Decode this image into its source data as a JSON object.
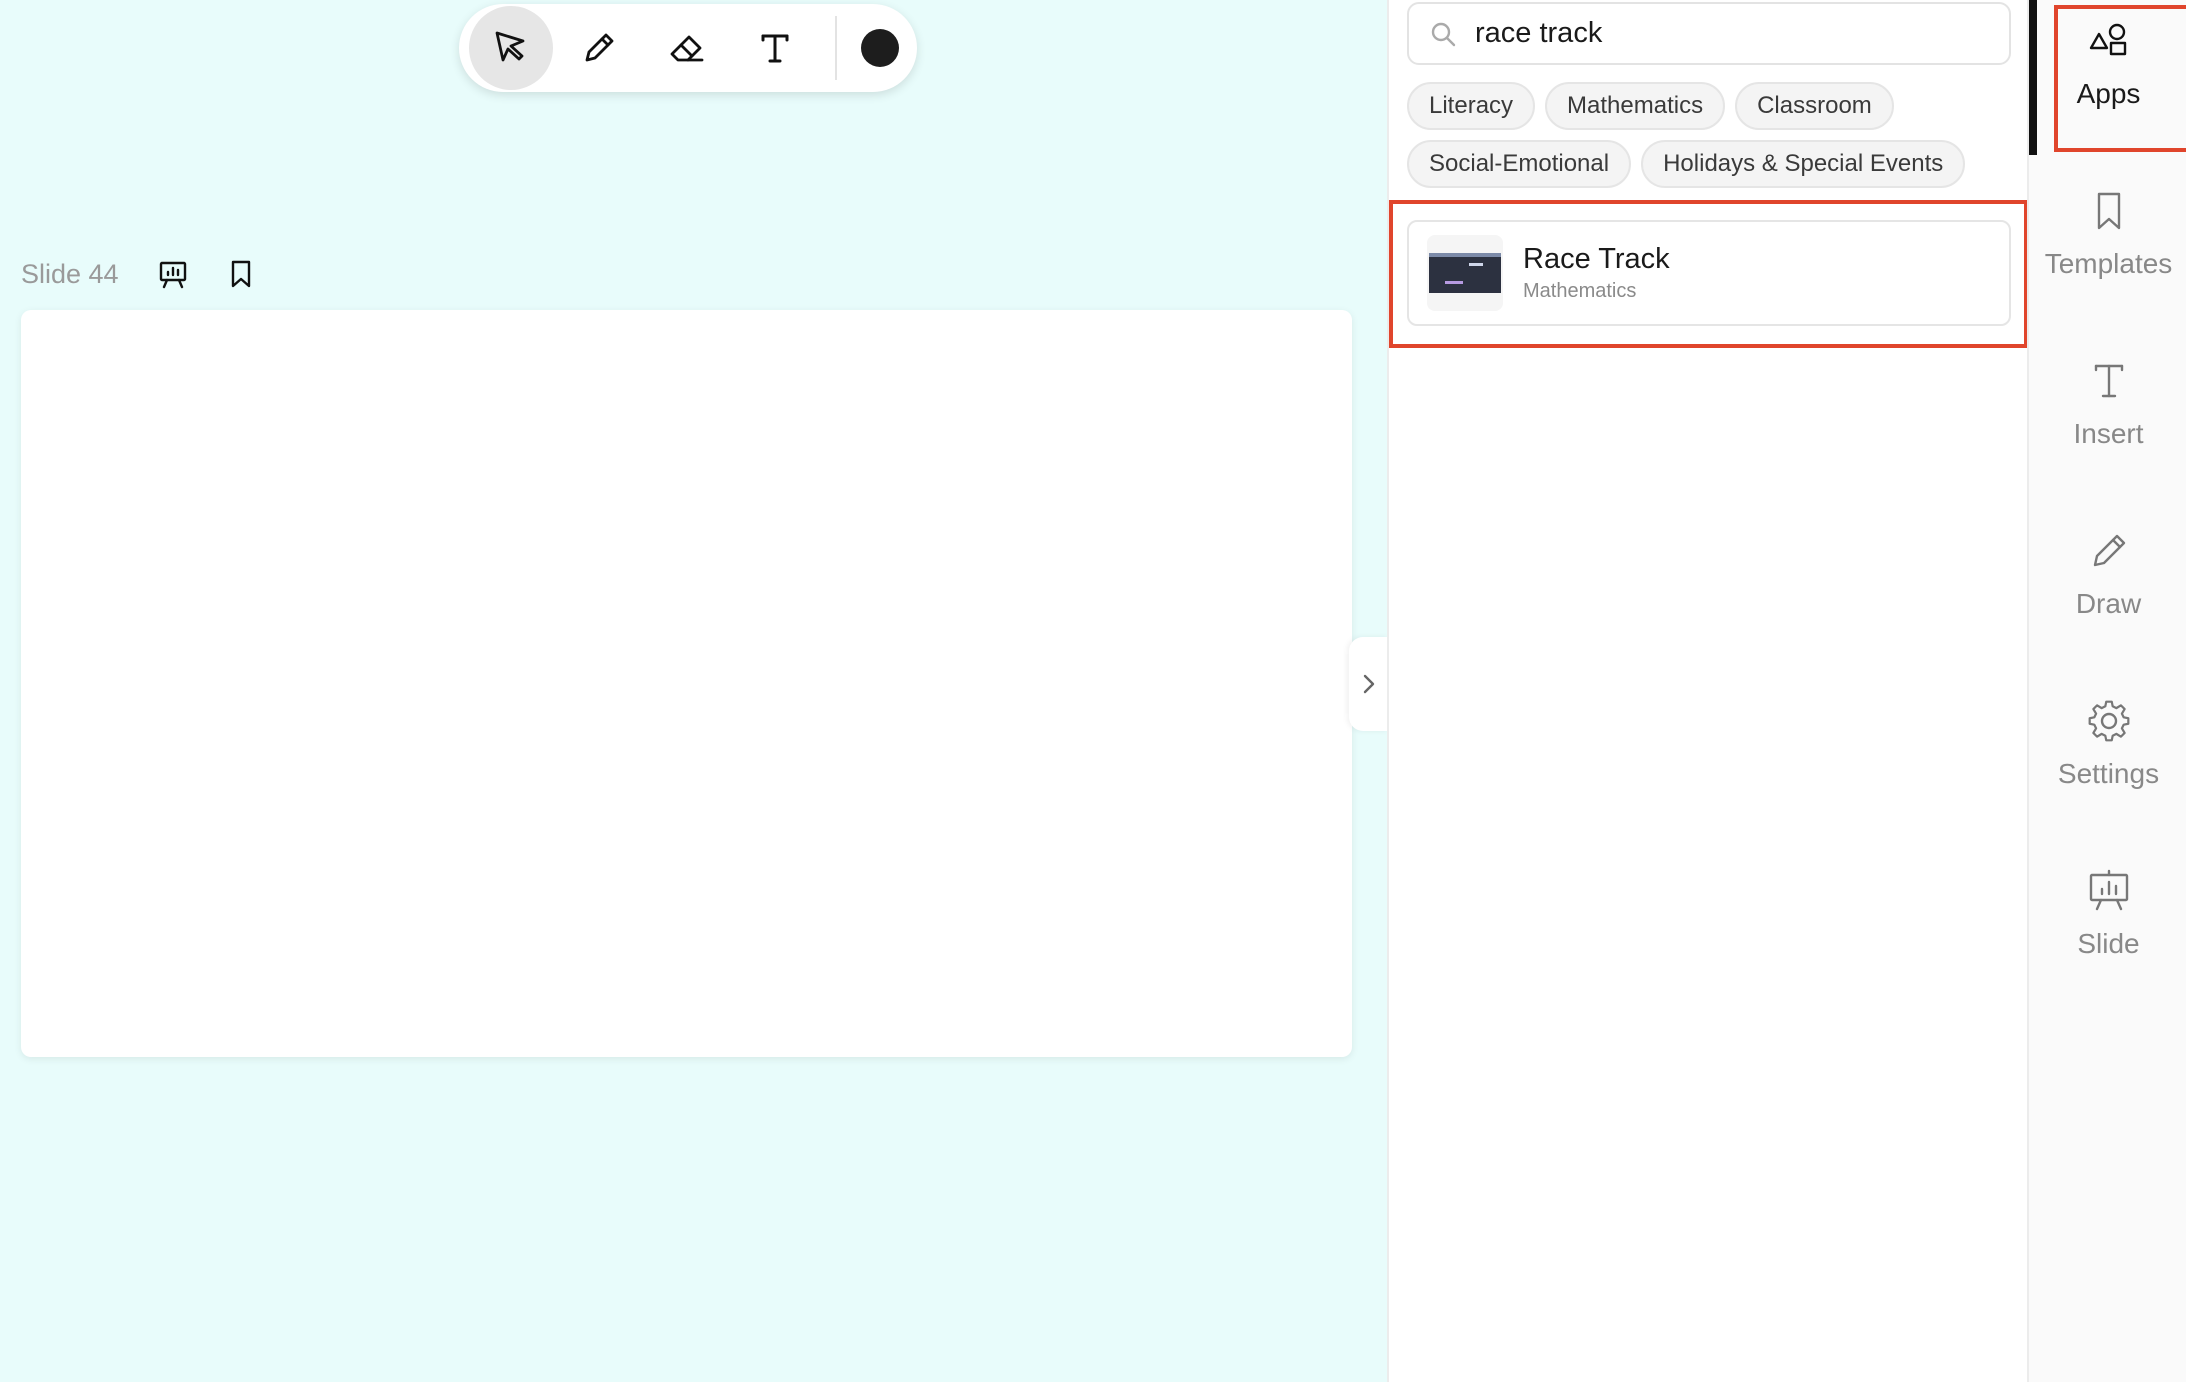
{
  "toolbar": {
    "tools": [
      {
        "name": "select-tool",
        "icon": "cursor-icon",
        "active": true
      },
      {
        "name": "pen-tool",
        "icon": "pencil-icon",
        "active": false
      },
      {
        "name": "eraser-tool",
        "icon": "eraser-icon",
        "active": false
      },
      {
        "name": "text-tool",
        "icon": "text-icon",
        "active": false
      }
    ],
    "color": "#1d1d1d"
  },
  "slide": {
    "label": "Slide 44"
  },
  "apps_panel": {
    "search": {
      "value": "race track",
      "placeholder": "Search"
    },
    "chips_row1": [
      "Literacy",
      "Mathematics",
      "Classroom"
    ],
    "chips_row2": [
      "Social-Emotional",
      "Holidays & Special Events"
    ],
    "results": [
      {
        "title": "Race Track",
        "category": "Mathematics"
      }
    ]
  },
  "nav": {
    "items": [
      {
        "label": "Apps",
        "icon": "apps-icon",
        "active": true
      },
      {
        "label": "Templates",
        "icon": "bookmark-icon",
        "active": false
      },
      {
        "label": "Insert",
        "icon": "text-icon",
        "active": false
      },
      {
        "label": "Draw",
        "icon": "pencil-icon",
        "active": false
      },
      {
        "label": "Settings",
        "icon": "gear-icon",
        "active": false
      },
      {
        "label": "Slide",
        "icon": "presentation-icon",
        "active": false
      }
    ]
  },
  "colors": {
    "canvas_bg": "#e8fcfb",
    "highlight": "#e0452c",
    "active_bar": "#111111"
  }
}
